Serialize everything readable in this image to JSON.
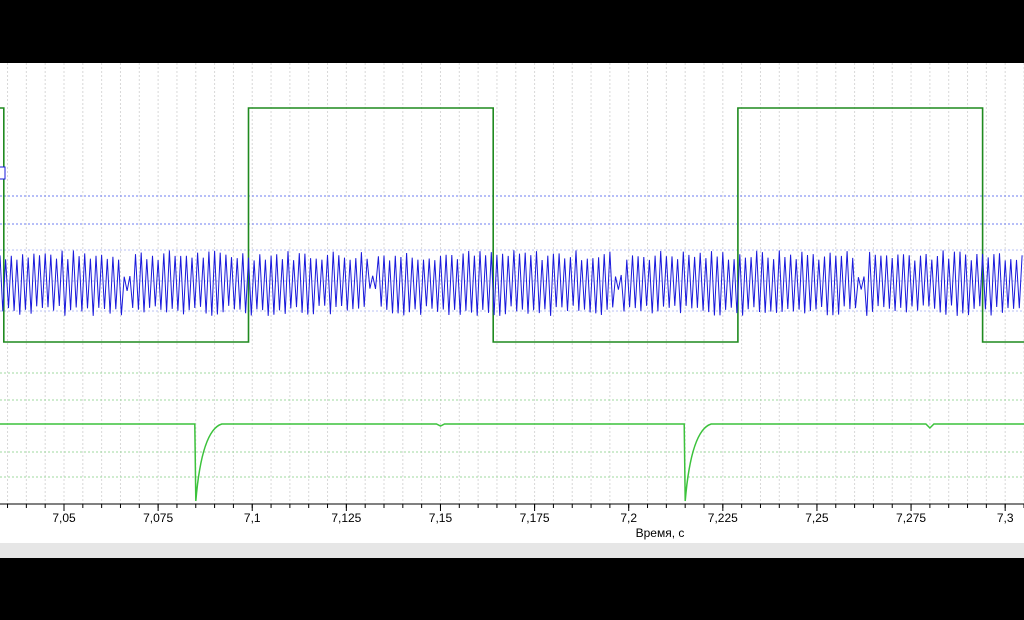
{
  "chart_data": {
    "type": "line",
    "xlabel": "Время, с",
    "xlim": [
      7.033,
      7.305
    ],
    "x_ticks": [
      "7,05",
      "7,075",
      "7,1",
      "7,125",
      "7,15",
      "7,175",
      "7,2",
      "7,225",
      "7,25",
      "7,275",
      "7,3"
    ],
    "x_tick_values": [
      7.05,
      7.075,
      7.1,
      7.125,
      7.15,
      7.175,
      7.2,
      7.225,
      7.25,
      7.275,
      7.3
    ],
    "grid": true,
    "series": [
      {
        "color": "#1f8a1f",
        "kind": "square",
        "high": 1,
        "low": 0,
        "transitions": [
          {
            "x": 7.034,
            "level": 0
          },
          {
            "x": 7.099,
            "level": 1
          },
          {
            "x": 7.164,
            "level": 0
          },
          {
            "x": 7.229,
            "level": 1
          },
          {
            "x": 7.294,
            "level": 0
          }
        ]
      },
      {
        "color": "#1a1adc",
        "kind": "oscillation",
        "x_range": [
          7.033,
          7.305
        ],
        "period": 0.0015,
        "dips": [
          7.067,
          7.132,
          7.197,
          7.262
        ]
      },
      {
        "color": "#3cc23c",
        "kind": "pulse",
        "baseline": 0,
        "spikes": [
          {
            "x": 7.085,
            "depth": 1
          },
          {
            "x": 7.215,
            "depth": 1
          },
          {
            "x": 7.15,
            "depth": 0.05
          },
          {
            "x": 7.28,
            "depth": 0.1
          }
        ]
      }
    ]
  }
}
